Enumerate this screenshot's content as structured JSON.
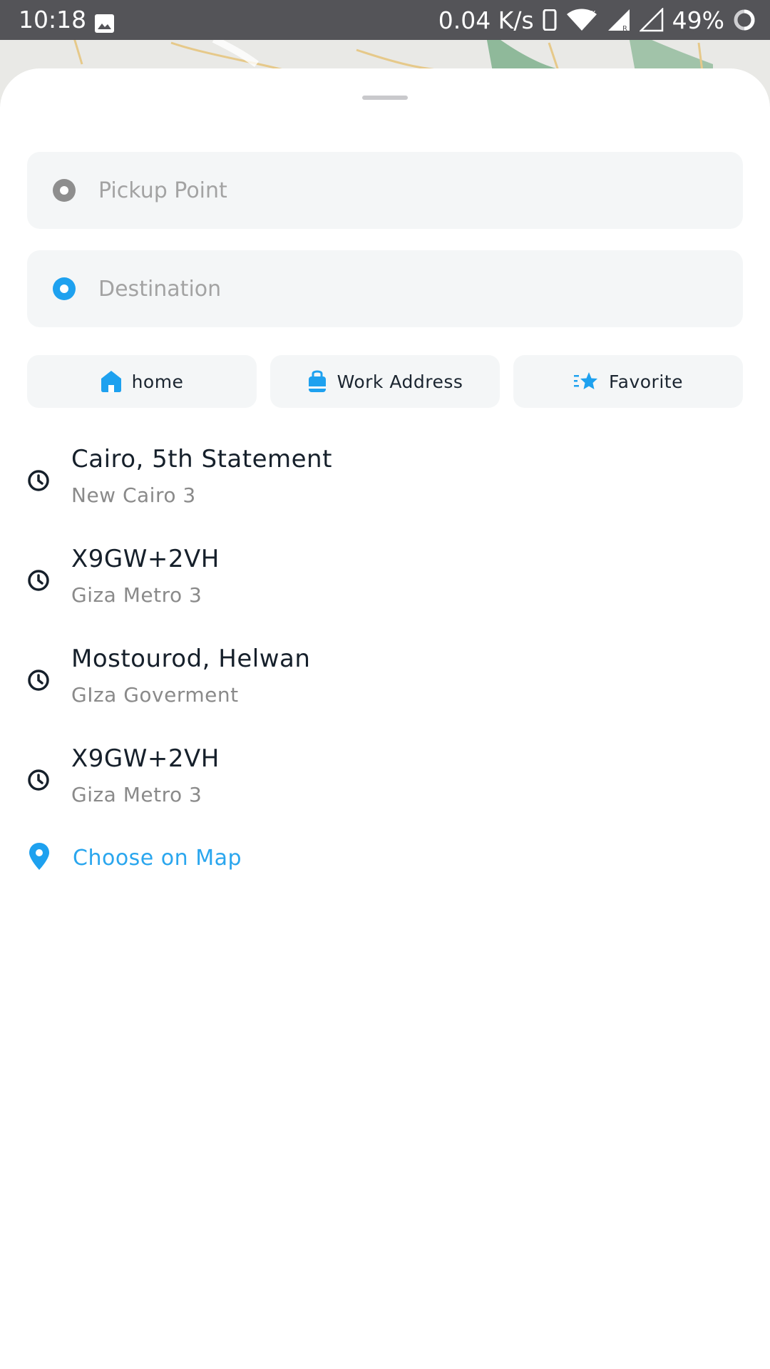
{
  "status_bar": {
    "time": "10:18",
    "network_speed": "0.04 K/s",
    "battery_percent": "49%",
    "icons": [
      "image-icon",
      "phone-icon",
      "wifi-icon",
      "signal-icon",
      "signal-empty-icon",
      "battery-ring-icon"
    ]
  },
  "search": {
    "pickup_placeholder": "Pickup Point",
    "pickup_value": "",
    "destination_placeholder": "Destination",
    "destination_value": ""
  },
  "quick_actions": [
    {
      "label": "home",
      "icon": "home-icon"
    },
    {
      "label": "Work Address",
      "icon": "briefcase-icon"
    },
    {
      "label": "Favorite",
      "icon": "star-icon"
    }
  ],
  "recent_places": [
    {
      "title": "Cairo, 5th Statement",
      "subtitle": "New Cairo 3",
      "icon": "clock-icon"
    },
    {
      "title": "X9GW+2VH",
      "subtitle": "Giza Metro 3",
      "icon": "clock-icon"
    },
    {
      "title": "Mostourod, Helwan",
      "subtitle": "GIza Goverment",
      "icon": "clock-icon"
    },
    {
      "title": "X9GW+2VH",
      "subtitle": "Giza Metro 3",
      "icon": "clock-icon"
    }
  ],
  "choose_on_map": {
    "label": "Choose on Map",
    "icon": "map-pin-icon"
  },
  "colors": {
    "accent": "#1ea1ef",
    "text_primary": "#16202b",
    "text_secondary": "#8a8a8a",
    "field_background": "#f4f6f7",
    "status_bar": "#545458"
  }
}
